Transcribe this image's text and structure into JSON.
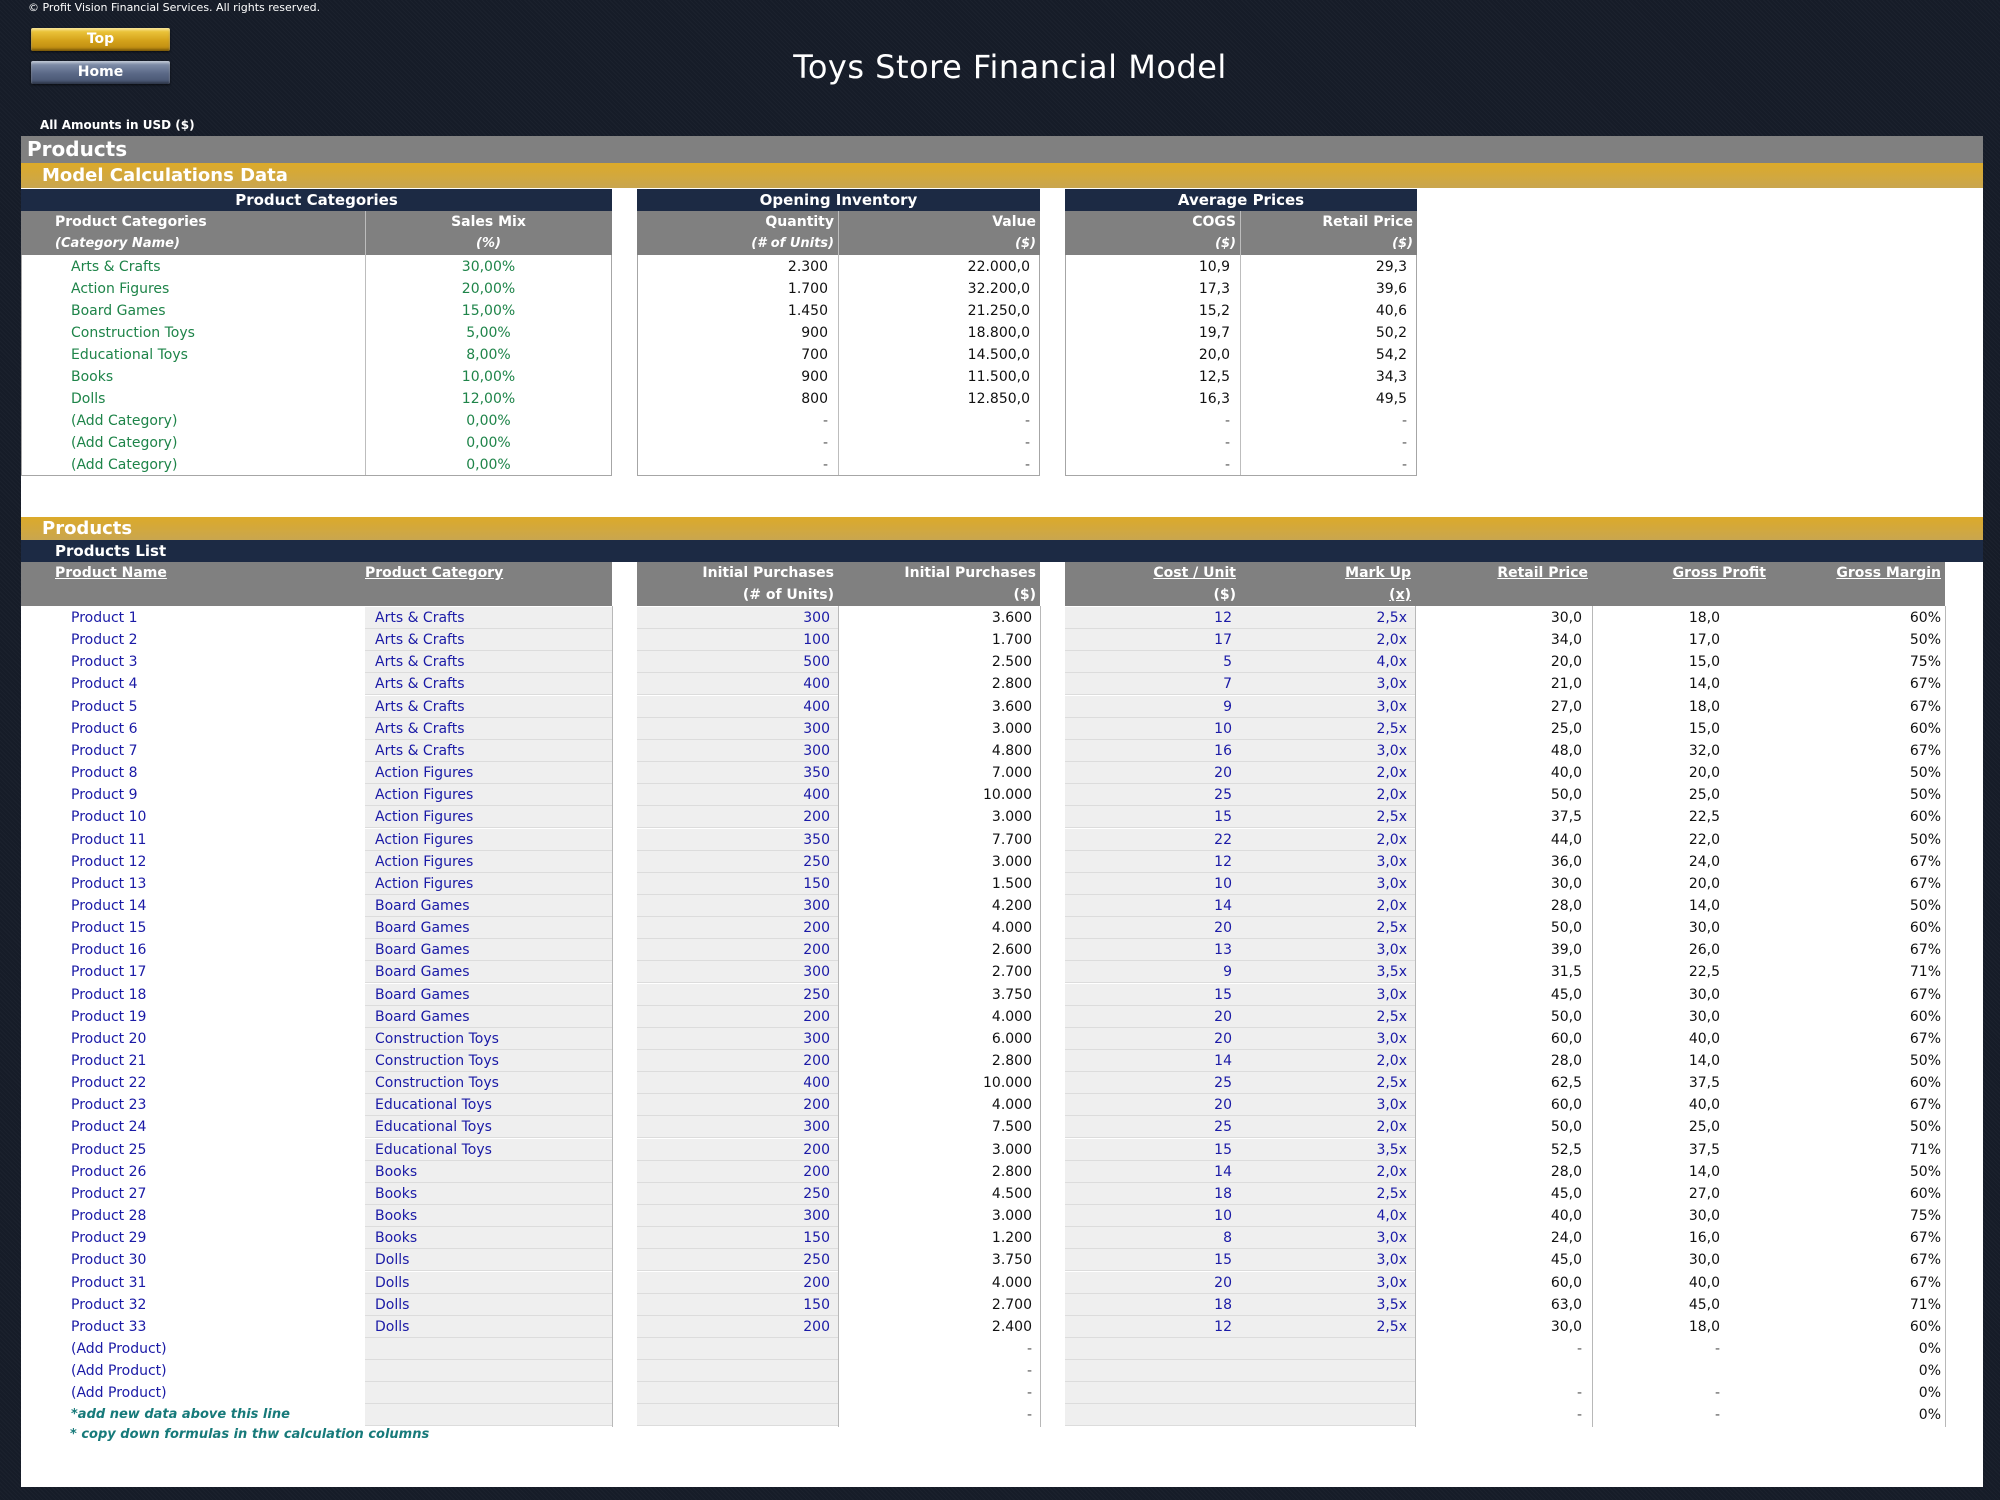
{
  "copyright": "© Profit Vision Financial Services. All rights reserved.",
  "nav": {
    "top_label": "Top",
    "home_label": "Home"
  },
  "title": "Toys Store Financial Model",
  "amounts_note": "All Amounts in  USD ($)",
  "page_band": "Products",
  "section1_band": "Model Calculations Data",
  "categories_table": {
    "title": "Product Categories",
    "headers": [
      {
        "label": "Product Categories",
        "sub": "(Category Name)"
      },
      {
        "label": "Sales Mix",
        "sub": "(%)"
      }
    ],
    "rows": [
      {
        "name": "Arts & Crafts",
        "mix": "30,00%"
      },
      {
        "name": "Action Figures",
        "mix": "20,00%"
      },
      {
        "name": "Board Games",
        "mix": "15,00%"
      },
      {
        "name": "Construction Toys",
        "mix": "5,00%"
      },
      {
        "name": "Educational Toys",
        "mix": "8,00%"
      },
      {
        "name": "Books",
        "mix": "10,00%"
      },
      {
        "name": "Dolls",
        "mix": "12,00%"
      },
      {
        "name": "(Add Category)",
        "mix": "0,00%"
      },
      {
        "name": "(Add Category)",
        "mix": "0,00%"
      },
      {
        "name": "(Add Category)",
        "mix": "0,00%"
      }
    ]
  },
  "inventory_table": {
    "title": "Opening Inventory",
    "headers": [
      {
        "label": "Quantity",
        "sub": "(# of Units)"
      },
      {
        "label": "Value",
        "sub": "($)"
      }
    ],
    "rows": [
      {
        "qty": "2.300",
        "value": "22.000,0"
      },
      {
        "qty": "1.700",
        "value": "32.200,0"
      },
      {
        "qty": "1.450",
        "value": "21.250,0"
      },
      {
        "qty": "900",
        "value": "18.800,0"
      },
      {
        "qty": "700",
        "value": "14.500,0"
      },
      {
        "qty": "900",
        "value": "11.500,0"
      },
      {
        "qty": "800",
        "value": "12.850,0"
      },
      {
        "qty": "-",
        "value": "-"
      },
      {
        "qty": "-",
        "value": "-"
      },
      {
        "qty": "-",
        "value": "-"
      }
    ]
  },
  "prices_table": {
    "title": "Average Prices",
    "headers": [
      {
        "label": "COGS",
        "sub": "($)"
      },
      {
        "label": "Retail Price",
        "sub": "($)"
      }
    ],
    "rows": [
      {
        "cogs": "10,9",
        "retail": "29,3"
      },
      {
        "cogs": "17,3",
        "retail": "39,6"
      },
      {
        "cogs": "15,2",
        "retail": "40,6"
      },
      {
        "cogs": "19,7",
        "retail": "50,2"
      },
      {
        "cogs": "20,0",
        "retail": "54,2"
      },
      {
        "cogs": "12,5",
        "retail": "34,3"
      },
      {
        "cogs": "16,3",
        "retail": "49,5"
      },
      {
        "cogs": "-",
        "retail": "-"
      },
      {
        "cogs": "-",
        "retail": "-"
      },
      {
        "cogs": "-",
        "retail": "-"
      }
    ]
  },
  "section2_band": "Products",
  "products_table": {
    "title": "Products List",
    "headers": [
      {
        "label": "Product Name",
        "sub": ""
      },
      {
        "label": "Product Category",
        "sub": ""
      },
      {
        "label": "Initial Purchases",
        "sub": "(# of Units)"
      },
      {
        "label": "Initial Purchases",
        "sub": "($)"
      },
      {
        "label": "Cost / Unit",
        "sub": "($)"
      },
      {
        "label": "Mark Up",
        "sub": "(x)"
      },
      {
        "label": "Retail Price",
        "sub": ""
      },
      {
        "label": "Gross Profit",
        "sub": ""
      },
      {
        "label": "Gross Margin",
        "sub": ""
      }
    ],
    "rows": [
      [
        "Product 1",
        "Arts & Crafts",
        "300",
        "3.600",
        "12",
        "2,5x",
        "30,0",
        "18,0",
        "60%"
      ],
      [
        "Product 2",
        "Arts & Crafts",
        "100",
        "1.700",
        "17",
        "2,0x",
        "34,0",
        "17,0",
        "50%"
      ],
      [
        "Product 3",
        "Arts & Crafts",
        "500",
        "2.500",
        "5",
        "4,0x",
        "20,0",
        "15,0",
        "75%"
      ],
      [
        "Product 4",
        "Arts & Crafts",
        "400",
        "2.800",
        "7",
        "3,0x",
        "21,0",
        "14,0",
        "67%"
      ],
      [
        "Product 5",
        "Arts & Crafts",
        "400",
        "3.600",
        "9",
        "3,0x",
        "27,0",
        "18,0",
        "67%"
      ],
      [
        "Product 6",
        "Arts & Crafts",
        "300",
        "3.000",
        "10",
        "2,5x",
        "25,0",
        "15,0",
        "60%"
      ],
      [
        "Product 7",
        "Arts & Crafts",
        "300",
        "4.800",
        "16",
        "3,0x",
        "48,0",
        "32,0",
        "67%"
      ],
      [
        "Product 8",
        "Action Figures",
        "350",
        "7.000",
        "20",
        "2,0x",
        "40,0",
        "20,0",
        "50%"
      ],
      [
        "Product 9",
        "Action Figures",
        "400",
        "10.000",
        "25",
        "2,0x",
        "50,0",
        "25,0",
        "50%"
      ],
      [
        "Product 10",
        "Action Figures",
        "200",
        "3.000",
        "15",
        "2,5x",
        "37,5",
        "22,5",
        "60%"
      ],
      [
        "Product 11",
        "Action Figures",
        "350",
        "7.700",
        "22",
        "2,0x",
        "44,0",
        "22,0",
        "50%"
      ],
      [
        "Product 12",
        "Action Figures",
        "250",
        "3.000",
        "12",
        "3,0x",
        "36,0",
        "24,0",
        "67%"
      ],
      [
        "Product 13",
        "Action Figures",
        "150",
        "1.500",
        "10",
        "3,0x",
        "30,0",
        "20,0",
        "67%"
      ],
      [
        "Product 14",
        "Board Games",
        "300",
        "4.200",
        "14",
        "2,0x",
        "28,0",
        "14,0",
        "50%"
      ],
      [
        "Product 15",
        "Board Games",
        "200",
        "4.000",
        "20",
        "2,5x",
        "50,0",
        "30,0",
        "60%"
      ],
      [
        "Product 16",
        "Board Games",
        "200",
        "2.600",
        "13",
        "3,0x",
        "39,0",
        "26,0",
        "67%"
      ],
      [
        "Product 17",
        "Board Games",
        "300",
        "2.700",
        "9",
        "3,5x",
        "31,5",
        "22,5",
        "71%"
      ],
      [
        "Product 18",
        "Board Games",
        "250",
        "3.750",
        "15",
        "3,0x",
        "45,0",
        "30,0",
        "67%"
      ],
      [
        "Product 19",
        "Board Games",
        "200",
        "4.000",
        "20",
        "2,5x",
        "50,0",
        "30,0",
        "60%"
      ],
      [
        "Product 20",
        "Construction Toys",
        "300",
        "6.000",
        "20",
        "3,0x",
        "60,0",
        "40,0",
        "67%"
      ],
      [
        "Product 21",
        "Construction Toys",
        "200",
        "2.800",
        "14",
        "2,0x",
        "28,0",
        "14,0",
        "50%"
      ],
      [
        "Product 22",
        "Construction Toys",
        "400",
        "10.000",
        "25",
        "2,5x",
        "62,5",
        "37,5",
        "60%"
      ],
      [
        "Product 23",
        "Educational Toys",
        "200",
        "4.000",
        "20",
        "3,0x",
        "60,0",
        "40,0",
        "67%"
      ],
      [
        "Product 24",
        "Educational Toys",
        "300",
        "7.500",
        "25",
        "2,0x",
        "50,0",
        "25,0",
        "50%"
      ],
      [
        "Product 25",
        "Educational Toys",
        "200",
        "3.000",
        "15",
        "3,5x",
        "52,5",
        "37,5",
        "71%"
      ],
      [
        "Product 26",
        "Books",
        "200",
        "2.800",
        "14",
        "2,0x",
        "28,0",
        "14,0",
        "50%"
      ],
      [
        "Product 27",
        "Books",
        "250",
        "4.500",
        "18",
        "2,5x",
        "45,0",
        "27,0",
        "60%"
      ],
      [
        "Product 28",
        "Books",
        "300",
        "3.000",
        "10",
        "4,0x",
        "40,0",
        "30,0",
        "75%"
      ],
      [
        "Product 29",
        "Books",
        "150",
        "1.200",
        "8",
        "3,0x",
        "24,0",
        "16,0",
        "67%"
      ],
      [
        "Product 30",
        "Dolls",
        "250",
        "3.750",
        "15",
        "3,0x",
        "45,0",
        "30,0",
        "67%"
      ],
      [
        "Product 31",
        "Dolls",
        "200",
        "4.000",
        "20",
        "3,0x",
        "60,0",
        "40,0",
        "67%"
      ],
      [
        "Product 32",
        "Dolls",
        "150",
        "2.700",
        "18",
        "3,5x",
        "63,0",
        "45,0",
        "71%"
      ],
      [
        "Product 33",
        "Dolls",
        "200",
        "2.400",
        "12",
        "2,5x",
        "30,0",
        "18,0",
        "60%"
      ],
      [
        "(Add Product)",
        "",
        "",
        "-",
        "",
        "",
        "-",
        "-",
        "0%"
      ],
      [
        "(Add Product)",
        "",
        "",
        "-",
        "",
        "",
        "",
        "",
        "0%"
      ],
      [
        "(Add Product)",
        "",
        "",
        "-",
        "",
        "",
        "-",
        "-",
        "0%"
      ],
      [
        "*add new data above this line",
        "",
        "",
        "-",
        "",
        "",
        "-",
        "-",
        "0%"
      ]
    ],
    "footnote": "* copy down formulas in thw calculation columns"
  }
}
